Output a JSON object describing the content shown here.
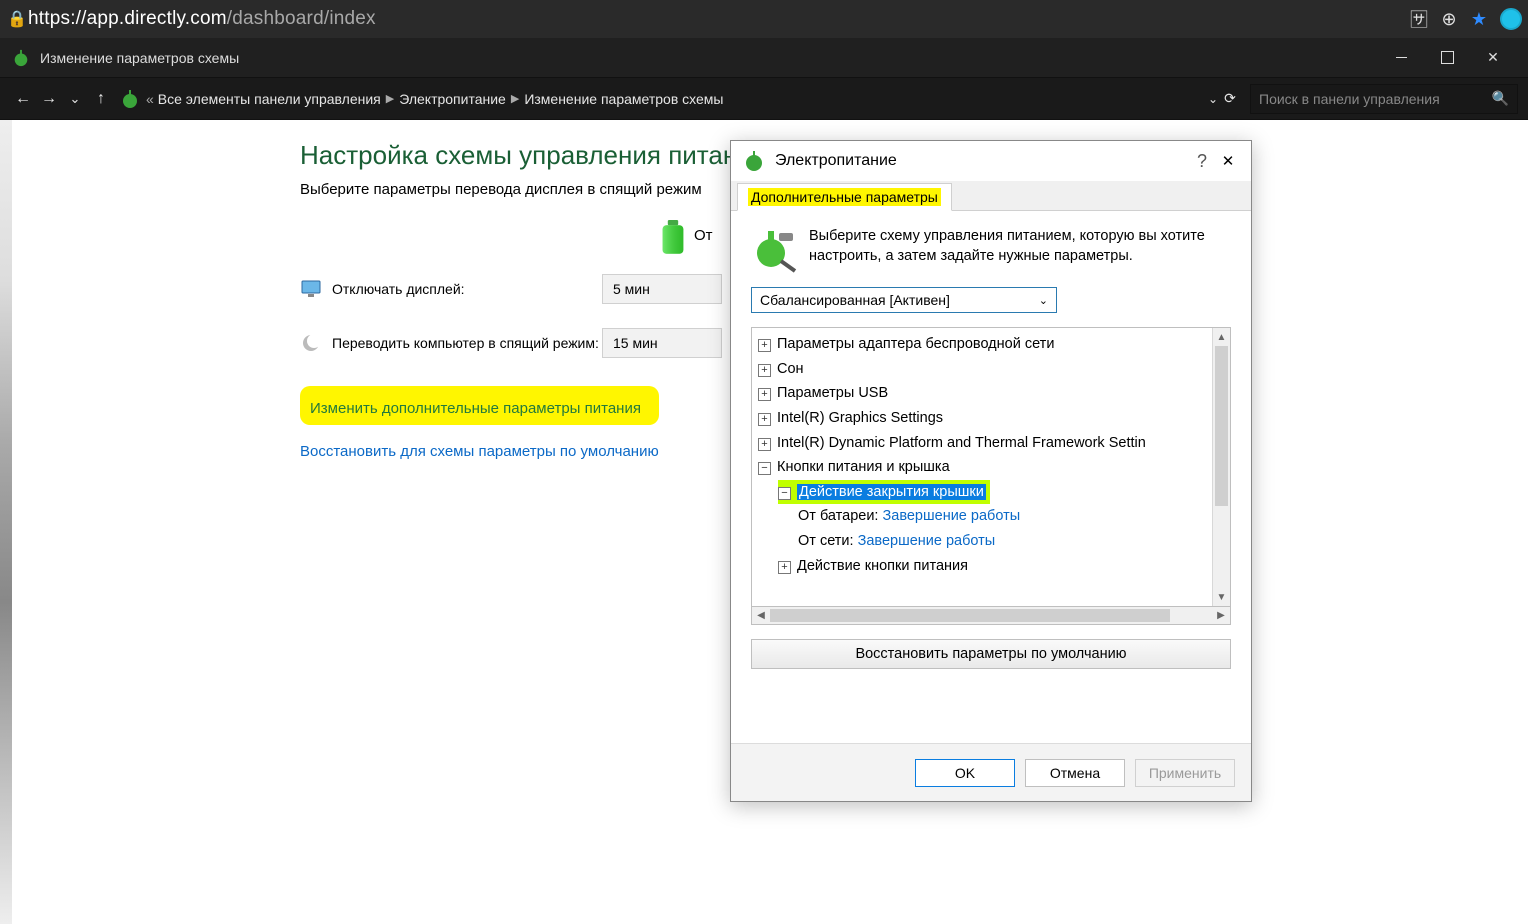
{
  "browser": {
    "url_host": "https://app.directly.com",
    "url_path": "/dashboard/index"
  },
  "app": {
    "title": "Изменение параметров схемы"
  },
  "breadcrumb": {
    "root": "Все элементы панели управления",
    "mid": "Электропитание",
    "leaf": "Изменение параметров схемы",
    "search_placeholder": "Поиск в панели управления"
  },
  "main": {
    "headline": "Настройка схемы управления питанием \"",
    "sub": "Выберите параметры перевода дисплея в спящий режим",
    "battery_label": "От",
    "display_off_label": "Отключать дисплей:",
    "display_off_value": "5 мин",
    "sleep_label": "Переводить компьютер в спящий режим:",
    "sleep_value": "15 мин",
    "advanced_link": "Изменить дополнительные параметры питания",
    "restore_link": "Восстановить для схемы параметры по умолчанию"
  },
  "dialog": {
    "title": "Электропитание",
    "tab_active": "Дополнительные параметры",
    "info": "Выберите схему управления питанием, которую вы хотите настроить, а затем задайте нужные параметры.",
    "select_value": "Сбалансированная [Активен]",
    "tree": {
      "wifi": "Параметры адаптера беспроводной сети",
      "sleep": "Сон",
      "usb": "Параметры USB",
      "intel_gfx": "Intel(R) Graphics Settings",
      "intel_dptf": "Intel(R) Dynamic Platform and Thermal Framework Settin",
      "buttons_lid": "Кнопки питания и крышка",
      "lid_action": "Действие закрытия крышки",
      "on_battery_label": "От батареи:",
      "on_battery_value": "Завершение работы",
      "on_ac_label": "От сети:",
      "on_ac_value": "Завершение работы",
      "power_button": "Действие кнопки питания"
    },
    "restore_defaults": "Восстановить параметры по умолчанию",
    "ok": "OK",
    "cancel": "Отмена",
    "apply": "Применить"
  }
}
